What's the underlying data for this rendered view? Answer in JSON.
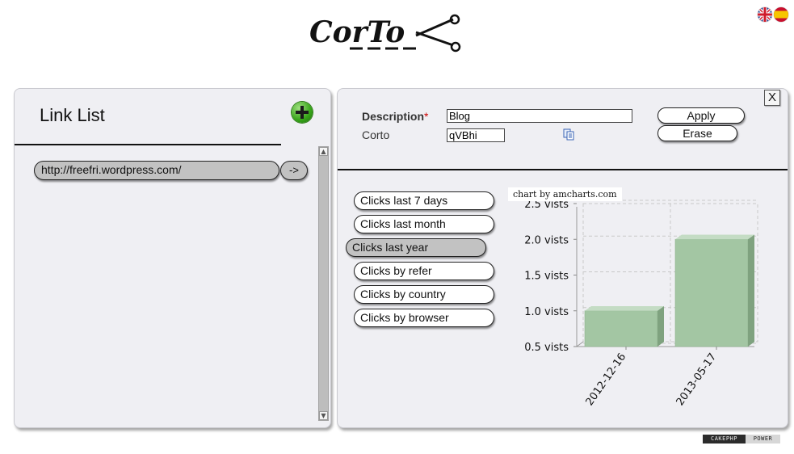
{
  "logo": {
    "text": "CorTo"
  },
  "languages": [
    {
      "name": "english-flag-icon"
    },
    {
      "name": "spanish-flag-icon"
    }
  ],
  "left_panel": {
    "title": "Link List",
    "add_icon": "plus-circle-icon",
    "links": [
      {
        "url": "http://freefri.wordpress.com/",
        "go_label": "->"
      }
    ]
  },
  "form": {
    "description_label": "Description",
    "required_mark": "*",
    "description_value": "Blog",
    "corto_label": "Corto",
    "corto_value": "qVBhi",
    "copy_icon": "copy-icon",
    "apply_label": "Apply",
    "erase_label": "Erase",
    "close_label": "X"
  },
  "stats": [
    {
      "label": "Clicks last 7 days",
      "active": false
    },
    {
      "label": "Clicks last month",
      "active": false
    },
    {
      "label": "Clicks last year",
      "active": true
    },
    {
      "label": "Clicks by refer",
      "active": false
    },
    {
      "label": "Clicks by country",
      "active": false
    },
    {
      "label": "Clicks by browser",
      "active": false
    }
  ],
  "chart_data": {
    "type": "bar",
    "credit": "chart by amcharts.com",
    "categories": [
      "2012-12-16",
      "2013-05-17"
    ],
    "values": [
      1,
      2
    ],
    "yticks": [
      "0.5 vists",
      "1.0 vists",
      "1.5 vists",
      "2.0 vists",
      "2.5 vists"
    ],
    "ytick_values": [
      0.5,
      1.0,
      1.5,
      2.0,
      2.5
    ],
    "ylim": [
      0.5,
      2.5
    ],
    "grid": true,
    "bar_color": "#a3c6a3"
  },
  "footer": {
    "badge_left": "CAKEPHP",
    "badge_right": "POWER"
  }
}
